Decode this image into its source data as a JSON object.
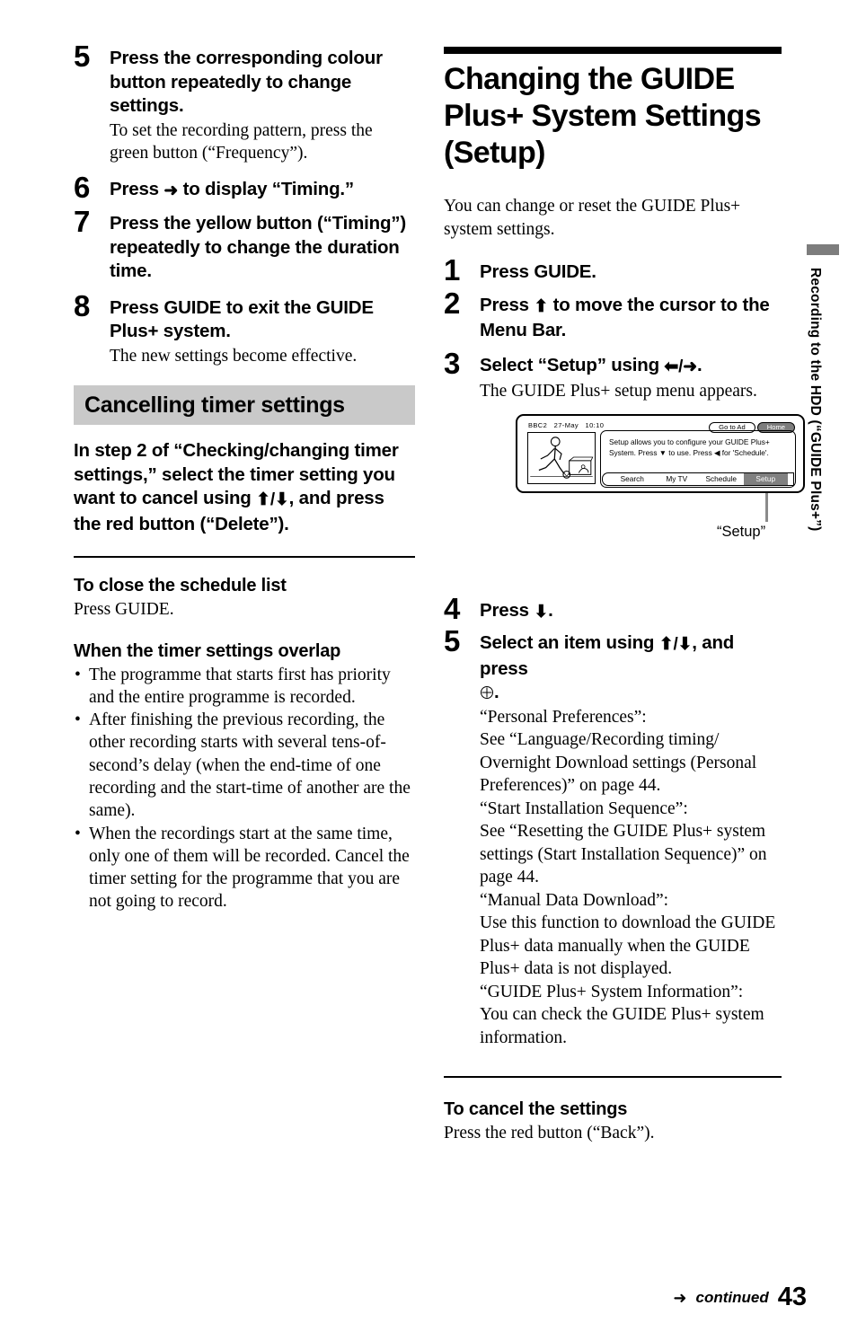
{
  "page": {
    "number": "43",
    "continued_label": "continued",
    "continued_arrow": "➜",
    "side_tab_label": "Recording to the HDD (“GUIDE Plus+”)"
  },
  "left_column": {
    "steps": [
      {
        "num": "5",
        "title": "Press the corresponding colour button repeatedly to change settings.",
        "desc": "To set the recording pattern, press the green button (“Frequency”)."
      },
      {
        "num": "6",
        "title_pre": "Press ",
        "title_arrow": "➜",
        "title_post": " to display “Timing.”",
        "desc": ""
      },
      {
        "num": "7",
        "title": "Press the yellow button (“Timing”) repeatedly to change the duration time.",
        "desc": ""
      },
      {
        "num": "8",
        "title": "Press GUIDE to exit the GUIDE Plus+ system.",
        "desc": "The new settings become effective."
      }
    ],
    "section_bar_title": "Cancelling timer settings",
    "cancel_intro_pre": "In step 2 of “Checking/changing timer settings,” select the timer setting you want to cancel using ",
    "cancel_intro_arrows": "⬆/⬇",
    "cancel_intro_post": ", and press the red button (“Delete”).",
    "close_schedule": {
      "heading": "To close the schedule list",
      "body": "Press GUIDE."
    },
    "overlap": {
      "heading": "When the timer settings overlap",
      "bullets": [
        "The programme that starts first has priority and the entire programme is recorded.",
        "After finishing the previous recording, the other recording starts with several tens-of-second’s delay (when the end-time of one recording and the start-time of another are the same).",
        "When the recordings start at the same time, only one of them will be recorded. Cancel the timer setting for the programme that you are not going to record."
      ]
    }
  },
  "right_column": {
    "main_title": "Changing the GUIDE Plus+ System Settings (Setup)",
    "intro": "You can change or reset the GUIDE Plus+ system settings.",
    "steps": [
      {
        "num": "1",
        "title": "Press GUIDE.",
        "desc": ""
      },
      {
        "num": "2",
        "title_pre": "Press ",
        "title_arrow": "⬆",
        "title_post": " to move the cursor to the Menu Bar.",
        "desc": ""
      },
      {
        "num": "3",
        "title_pre": "Select “Setup” using ",
        "title_arrow": "⬅/➜",
        "title_post": ".",
        "desc": "The GUIDE Plus+ setup menu appears."
      },
      {
        "num": "4",
        "title_pre": "Press ",
        "title_arrow": "⬇",
        "title_post": ".",
        "desc": ""
      },
      {
        "num": "5",
        "title_pre": "Select an item using ",
        "title_arrow": "⬆/⬇",
        "title_post": ", and press",
        "desc": ""
      }
    ],
    "figure": {
      "channel": "BBC2",
      "date": "27-May",
      "time": "10:10",
      "pills": [
        {
          "label": "Go to Ad",
          "style": "light"
        },
        {
          "label": "Home",
          "style": "dark"
        }
      ],
      "panel_text": "Setup allows you to configure your GUIDE Plus+ System. Press ▼ to use. Press ◀ for 'Schedule'.",
      "menu_items": [
        {
          "label": "Search",
          "selected": false
        },
        {
          "label": "My TV",
          "selected": false
        },
        {
          "label": "Schedule",
          "selected": false
        },
        {
          "label": "Setup",
          "selected": true
        }
      ],
      "callout": "“Setup”"
    },
    "step5_body": [
      "“Personal Preferences”:",
      "See “Language/Recording timing/ Overnight Download settings (Personal Preferences)” on page 44.",
      "“Start Installation Sequence”:",
      "See “Resetting the GUIDE Plus+ system settings (Start Installation Sequence)” on page 44.",
      "“Manual Data Download”:",
      "Use this function to download the GUIDE Plus+ data manually when the GUIDE Plus+ data is not displayed.",
      "“GUIDE Plus+ System Information”:",
      "You can check the GUIDE Plus+ system information."
    ],
    "cancel_settings": {
      "heading": "To cancel the settings",
      "body": "Press the red button (“Back”)."
    }
  },
  "colors": {
    "section_bar": "#c9c9c9",
    "selected_menu": "#808080",
    "tab_mark": "#7d7d7d"
  }
}
